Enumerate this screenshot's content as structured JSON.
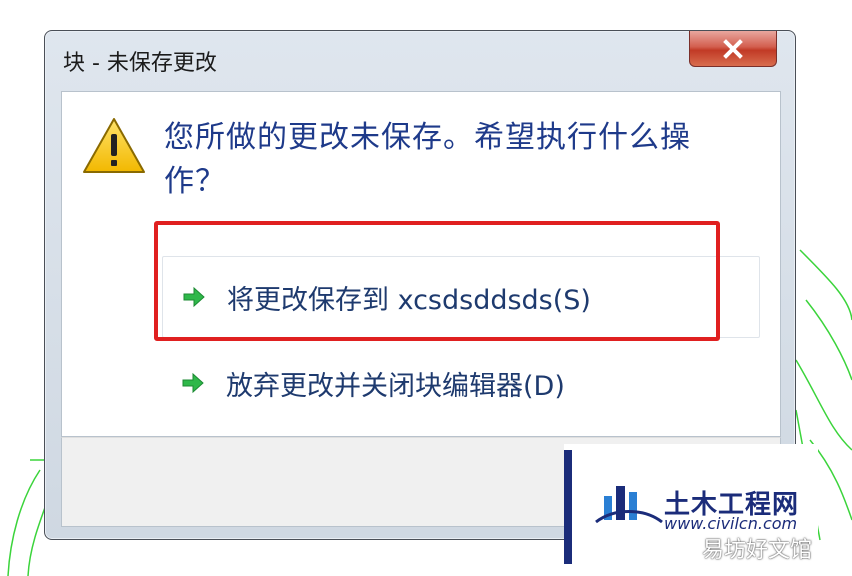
{
  "dialog": {
    "title": "块 - 未保存更改",
    "message": "您所做的更改未保存。希望执行什么操作？",
    "options": [
      {
        "label": "将更改保存到 xcsdsddsds(S)",
        "icon": "green-arrow-icon"
      },
      {
        "label": "放弃更改并关闭块编辑器(D)",
        "icon": "green-arrow-icon"
      }
    ],
    "close_icon": "close-icon",
    "warning_icon": "warning-icon"
  },
  "watermark": {
    "name": "土木工程网",
    "url": "www.civilcn.com",
    "source": "易坊好文馆"
  },
  "colors": {
    "highlight": "#e02020",
    "message_text": "#1e3a8a",
    "arrow": "#2fb84a",
    "cad_lines": "#3bd43b"
  }
}
